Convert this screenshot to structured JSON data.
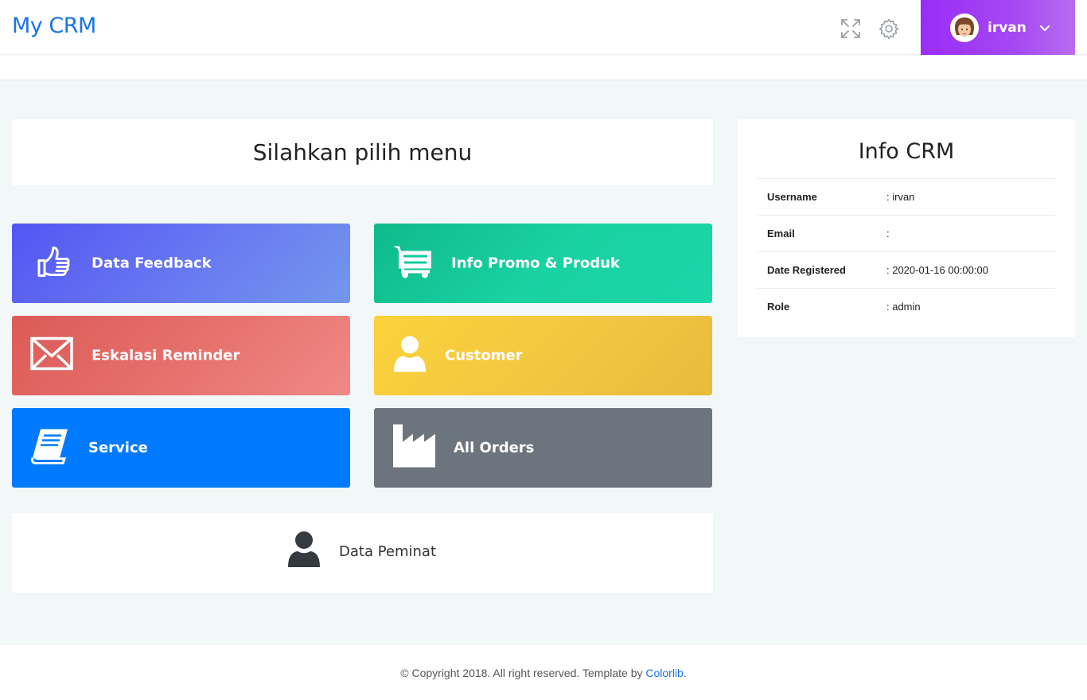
{
  "header": {
    "brand": "My CRM",
    "user": {
      "name": "irvan"
    },
    "icons": [
      "fullscreen-icon",
      "gear-icon",
      "chevron-down-icon"
    ]
  },
  "main": {
    "title": "Silahkan pilih menu",
    "tiles": [
      {
        "label": "Data Feedback",
        "icon": "thumbs-up-icon",
        "color": "#5c63f2"
      },
      {
        "label": "Info Promo & Produk",
        "icon": "cart-icon",
        "color": "#16c89b"
      },
      {
        "label": "Eskalasi Reminder",
        "icon": "envelope-icon",
        "color": "#e56b67"
      },
      {
        "label": "Customer",
        "icon": "user-icon",
        "color": "#f3c73e"
      },
      {
        "label": "Service",
        "icon": "book-icon",
        "color": "#007bff"
      },
      {
        "label": "All Orders",
        "icon": "factory-icon",
        "color": "#6c757d"
      }
    ],
    "peminat": {
      "label": "Data Peminat",
      "icon": "user-icon"
    }
  },
  "info": {
    "title": "Info CRM",
    "rows": [
      {
        "key": "Username",
        "value": ": irvan"
      },
      {
        "key": "Email",
        "value": ":"
      },
      {
        "key": "Date Registered",
        "value": ": 2020-01-16 00:00:00"
      },
      {
        "key": "Role",
        "value": ": admin"
      }
    ]
  },
  "footer": {
    "text": "© Copyright 2018. All right reserved. Template by ",
    "link": "Colorlib",
    "suffix": "."
  }
}
